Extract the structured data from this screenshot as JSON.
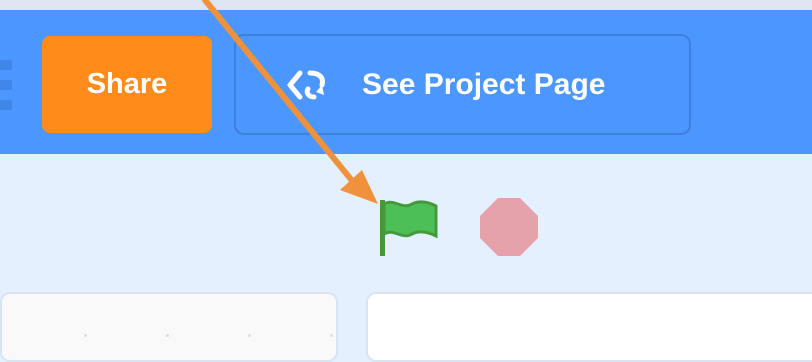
{
  "menu_bar": {
    "share_label": "Share",
    "project_page_label": "See Project Page",
    "project_page_icon": "remix-arrows-icon"
  },
  "stage_controls": {
    "green_flag_icon": "green-flag-icon",
    "stop_icon": "stop-sign-icon"
  },
  "colors": {
    "menu_bar": "#4c97ff",
    "share_button": "#ff8c1a",
    "stage_bar": "#e5f0ff",
    "green_flag": "#4cbf56",
    "stop": "#e6a2ab",
    "annotation_arrow": "#f0913c"
  }
}
